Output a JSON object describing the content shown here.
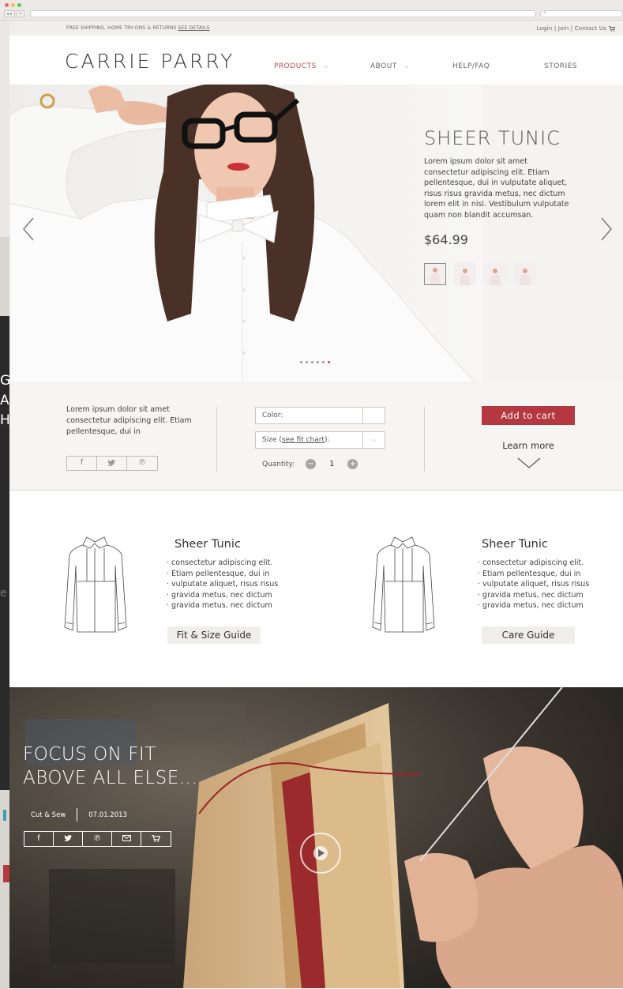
{
  "topbar": {
    "shipping_text": "FREE SHIPPING, HOME TRY-ONS & RETURNS",
    "shipping_link": "SEE DETAILS",
    "account_links": "Login | Join | Contact Us"
  },
  "header": {
    "logo": "CARRIE PARRY",
    "nav": [
      {
        "label": "PRODUCTS",
        "has_dropdown": true,
        "active": true
      },
      {
        "label": "ABOUT",
        "has_dropdown": true,
        "active": false
      },
      {
        "label": "HELP/FAQ",
        "has_dropdown": false,
        "active": false
      },
      {
        "label": "STORIES",
        "has_dropdown": false,
        "active": false
      }
    ]
  },
  "hero": {
    "title": "SHEER TUNIC",
    "description": "Lorem ipsum dolor sit amet consectetur adipiscing elit. Etiam pellentesque, dui in vulputate aliquet, risus risus gravida metus, nec dictum lorem elit in nisi. Vestibulum vulputate quam non blandit accumsan.",
    "price": "$64.99",
    "thumbnail_count": 4,
    "selected_thumbnail": 0,
    "carousel_dots": 6,
    "active_dot": 5
  },
  "purchase": {
    "description": "Lorem ipsum dolor sit amet consectetur adipiscing elit. Etiam pellentesque, dui in",
    "social_icons": [
      "facebook-icon",
      "twitter-icon",
      "pinterest-icon"
    ],
    "social_glyphs": [
      "f",
      "🐦",
      "℗"
    ],
    "color_label": "Color:",
    "size_label": "Size (",
    "size_link": "see fit chart",
    "size_label_end": "):",
    "quantity_label": "Quantity:",
    "quantity_value": "1",
    "add_to_cart": "Add to cart",
    "learn_more": "Learn more",
    "accent_color": "#b5373f"
  },
  "guides": [
    {
      "title": "Sheer Tunic",
      "bullets": [
        "· consectetur adipiscing elit.",
        "· Etiam pellentesque, dui in",
        "· vulputate aliquet, risus risus",
        "· gravida metus, nec dictum",
        "· gravida metus, nec dictum"
      ],
      "button": "Fit & Size Guide"
    },
    {
      "title": "Sheer Tunic",
      "bullets": [
        "· consectetur adipiscing elit.",
        "· Etiam pellentesque, dui in",
        "· vulputate aliquet, risus risus",
        "· gravida metus, nec dictum",
        "· gravida metus, nec dictum"
      ],
      "button": "Care Guide"
    }
  ],
  "video": {
    "title_line1": "FOCUS ON FIT",
    "title_line2": "ABOVE ALL ELSE...",
    "category": "Cut & Sew",
    "date": "07.01.2013",
    "share_icons": [
      "facebook-icon",
      "twitter-icon",
      "pinterest-icon",
      "email-icon",
      "cart-icon"
    ],
    "share_glyphs": [
      "f",
      "🐦",
      "℗",
      "✉",
      "🛒"
    ]
  },
  "background_window": {
    "letters": [
      "G",
      "A",
      "H"
    ],
    "side_text": "e"
  }
}
